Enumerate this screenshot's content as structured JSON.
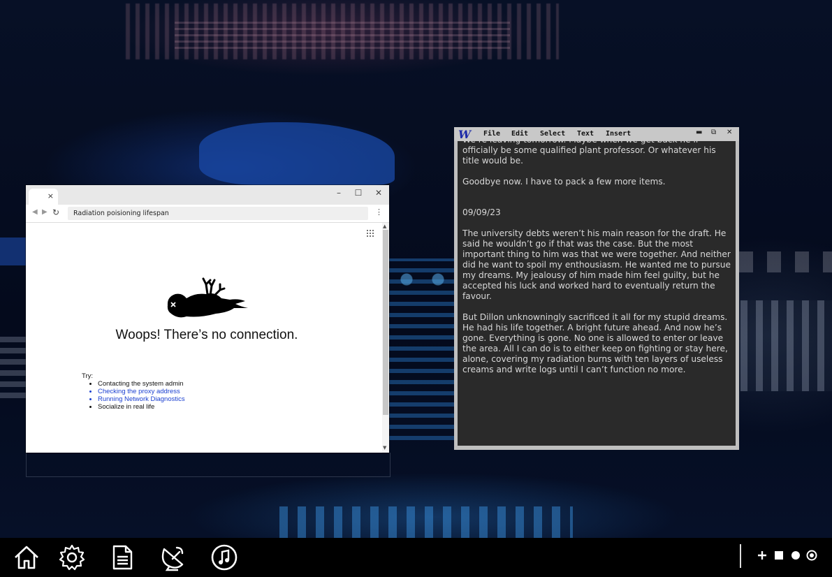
{
  "browser": {
    "tab_close": "×",
    "window_controls": {
      "minimize": "–",
      "maximize": "☐",
      "close": "✕"
    },
    "address": "Radiation poisioning lifespan",
    "menu": "⋮",
    "error_title": "Woops! There’s no connection.",
    "try_label": "Try:",
    "suggestions": [
      "Contacting the system admin",
      "Checking the proxy address",
      "Running Network Diagnostics",
      "Socialize in real life"
    ]
  },
  "writer": {
    "logo": "W",
    "menu": [
      "File",
      "Edit",
      "Select",
      "Text",
      "Insert"
    ],
    "controls": {
      "minimize": "▬",
      "restore": "⧉",
      "close": "✕"
    },
    "paragraphs": [
      "We’re leaving tomorrow. Maybe when we get back he’ll officially be some qualified plant professor. Or whatever his title would be.",
      "Goodbye now. I have to pack a few more items.",
      "09/09/23",
      "The university debts weren’t his main reason for the draft. He said he wouldn’t go if that was the case. But the most important thing to him was that we were together. And neither did he want to spoil my enthousiasm. He wanted me to pursue my dreams. My jealousy of him made him feel guilty, but he accepted his luck and worked hard to eventually return the favour.",
      "But Dillon unknowningly sacrificed it all for my stupid dreams. He had his life together. A bright future ahead. And now he’s gone. Everything is gone. No one is allowed to enter or leave the area. All I can do is to either keep on fighting or stay here, alone, covering my radiation burns with ten layers of useless creams and write logs until I can’t function no more."
    ]
  },
  "taskbar": {
    "apps": [
      "home-icon",
      "settings-icon",
      "document-icon",
      "satellite-icon",
      "music-icon"
    ],
    "controls": [
      "plus-icon",
      "square-icon",
      "circle-icon",
      "target-icon"
    ],
    "colors": {
      "icon": "#ffffff",
      "background": "#000000"
    }
  }
}
